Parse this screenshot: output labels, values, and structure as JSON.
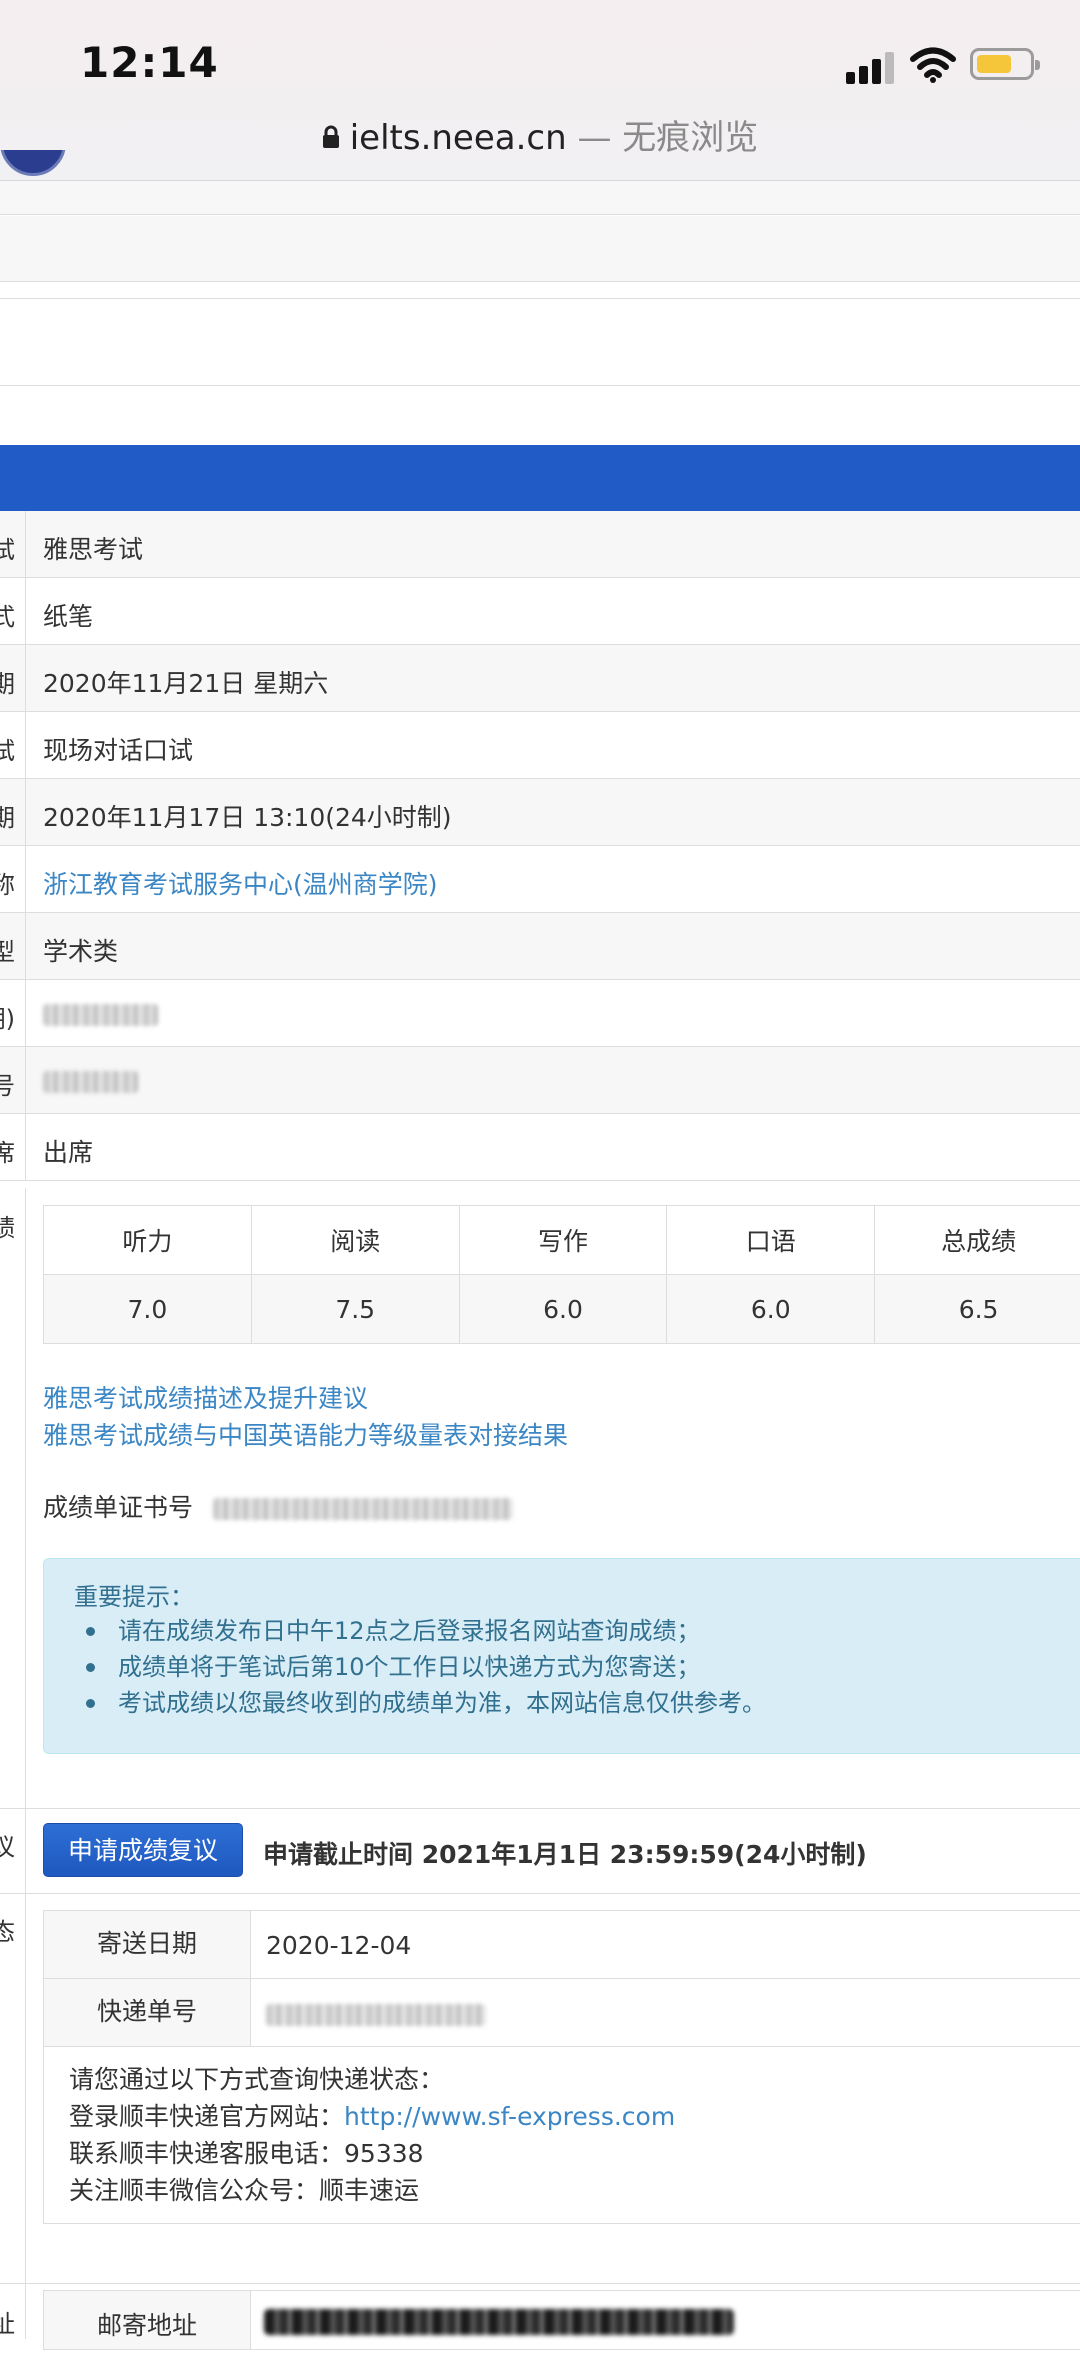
{
  "status_bar": {
    "time": "12:14"
  },
  "browser": {
    "domain": "ielts.neea.cn",
    "mode_suffix": "— 无痕浏览"
  },
  "info_rows": [
    {
      "label_tail": "试",
      "value": "雅思考试",
      "link": false
    },
    {
      "label_tail": "式",
      "value": "纸笔",
      "link": false
    },
    {
      "label_tail": "期",
      "value": "2020年11月21日 星期六",
      "link": false
    },
    {
      "label_tail": "试",
      "value": "现场对话口试",
      "link": false
    },
    {
      "label_tail": "期",
      "value": "2020年11月17日 13:10(24小时制)",
      "link": false
    },
    {
      "label_tail": "称",
      "value": "浙江教育考试服务中心(温州商学院)",
      "link": true
    },
    {
      "label_tail": "型",
      "value": "学术类",
      "link": false
    },
    {
      "label_tail": "期)",
      "value": "",
      "link": false
    },
    {
      "label_tail": "号",
      "value": "",
      "link": false
    },
    {
      "label_tail": "席",
      "value": "出席",
      "link": false
    }
  ],
  "scores": {
    "label_tail": "绩",
    "headers": [
      "听力",
      "阅读",
      "写作",
      "口语",
      "总成绩"
    ],
    "values": [
      "7.0",
      "7.5",
      "6.0",
      "6.0",
      "6.5"
    ],
    "link1": "雅思考试成绩描述及提升建议",
    "link2": "雅思考试成绩与中国英语能力等级量表对接结果",
    "cert_label": "成绩单证书号"
  },
  "notice": {
    "title": "重要提示：",
    "items": [
      "请在成绩发布日中午12点之后登录报名网站查询成绩；",
      "成绩单将于笔试后第10个工作日以快递方式为您寄送；",
      "考试成绩以您最终收到的成绩单为准，本网站信息仅供参考。"
    ]
  },
  "review": {
    "label_tail": "议",
    "button": "申请成绩复议",
    "deadline": "申请截止时间 2021年1月1日 23:59:59(24小时制)"
  },
  "delivery": {
    "label_tail": "态",
    "send_date_label": "寄送日期",
    "send_date": "2020-12-04",
    "tracking_label": "快递单号",
    "note_line1": "请您通过以下方式查询快递状态：",
    "note_line2_prefix": "登录顺丰快递官方网站：",
    "note_line2_url": "http://www.sf-express.com",
    "note_line3": "联系顺丰快递客服电话：95338",
    "note_line4": "关注顺丰微信公众号：顺丰速运"
  },
  "address": {
    "label_tail": "址",
    "label": "邮寄地址"
  },
  "colors": {
    "accent": "#215bc6",
    "link": "#3b86c4",
    "notice_bg": "#d9edf7",
    "notice_text": "#31708f"
  }
}
